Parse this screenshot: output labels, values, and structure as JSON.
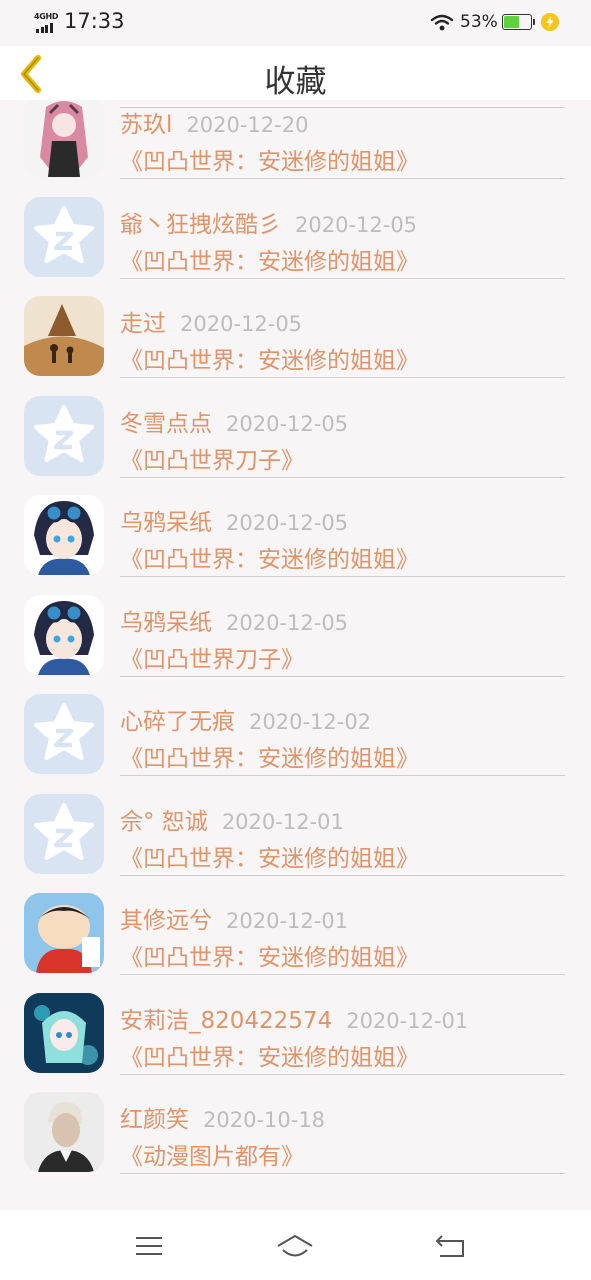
{
  "status_bar": {
    "network": "4GHD",
    "time": "17:33",
    "battery_percent": "53%",
    "battery_level": 0.53
  },
  "header": {
    "title": "收藏"
  },
  "favorites": [
    {
      "name": "苏玖l",
      "date": "2020-12-20",
      "title": "《凹凸世界：安迷修的姐姐》",
      "avatar": "anime-girl-pink"
    },
    {
      "name": "爺丶狂拽炫酷彡",
      "date": "2020-12-05",
      "title": "《凹凸世界：安迷修的姐姐》",
      "avatar": "qq-default"
    },
    {
      "name": "走过",
      "date": "2020-12-05",
      "title": "《凹凸世界：安迷修的姐姐》",
      "avatar": "sunset-silhouette"
    },
    {
      "name": "冬雪点点",
      "date": "2020-12-05",
      "title": "《凹凸世界刀子》",
      "avatar": "qq-default"
    },
    {
      "name": "乌鸦呆纸",
      "date": "2020-12-05",
      "title": "《凹凸世界：安迷修的姐姐》",
      "avatar": "anime-boy-goggles"
    },
    {
      "name": "乌鸦呆纸",
      "date": "2020-12-05",
      "title": "《凹凸世界刀子》",
      "avatar": "anime-boy-goggles"
    },
    {
      "name": "心碎了无痕",
      "date": "2020-12-02",
      "title": "《凹凸世界：安迷修的姐姐》",
      "avatar": "qq-default"
    },
    {
      "name": "佘° 恕诚",
      "date": "2020-12-01",
      "title": "《凹凸世界：安迷修的姐姐》",
      "avatar": "qq-default"
    },
    {
      "name": "其修远兮",
      "date": "2020-12-01",
      "title": "《凹凸世界：安迷修的姐姐》",
      "avatar": "cartoon-kid"
    },
    {
      "name": "安莉洁_820422574",
      "date": "2020-12-01",
      "title": "《凹凸世界：安迷修的姐姐》",
      "avatar": "anime-girl-blue"
    },
    {
      "name": "红颜笑",
      "date": "2020-10-18",
      "title": "《动漫图片都有》",
      "avatar": "portrait-photo"
    }
  ],
  "colors": {
    "accent": "#e0946a",
    "date": "#bdbdbd",
    "back_icon": "#e6b800",
    "qq_avatar": "#d9e4f3"
  },
  "nav": {
    "menu_icon": "menu-icon",
    "home_icon": "home-icon",
    "back_icon": "back-icon"
  }
}
